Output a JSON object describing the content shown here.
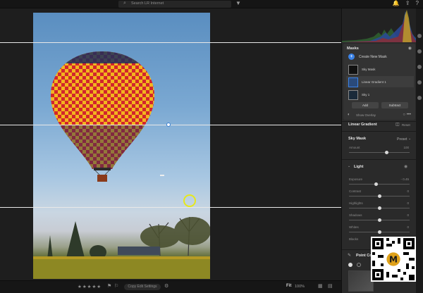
{
  "toolbar": {
    "search_placeholder": "Search LR Internet"
  },
  "masks_panel": {
    "title": "Masks",
    "create_label": "Create New Mask",
    "items": [
      {
        "label": "Sky Mask"
      },
      {
        "label": "Linear Gradient 1"
      },
      {
        "label": "Sky 1"
      }
    ],
    "add_label": "Add",
    "subtract_label": "Subtract",
    "show_overlay_label": "Show Overlay"
  },
  "adjust": {
    "section_title": "Linear Gradient",
    "reset_label": "Reset",
    "mask_name": "Sky Mask",
    "preset_label": "Preset",
    "amount_label": "Amount",
    "amount_value": "100",
    "light_title": "Light",
    "sliders": [
      {
        "label": "Exposure",
        "value": "- 0.45"
      },
      {
        "label": "Contrast",
        "value": "0"
      },
      {
        "label": "Highlights",
        "value": "0"
      },
      {
        "label": "Shadows",
        "value": "0"
      },
      {
        "label": "Whites",
        "value": "0"
      },
      {
        "label": "Blacks",
        "value": "0"
      }
    ],
    "point_color_title": "Point Color"
  },
  "filmstrip": {
    "copy_button": "Copy Edit Settings",
    "fit_label": "Fit",
    "zoom_value": "100%"
  },
  "colors": {
    "accent": "#3b82e6",
    "cursor_highlight": "#e6e81a",
    "balloon_red": "#d2252d",
    "balloon_yellow": "#f2b51e",
    "balloon_navy": "#1f2f5c"
  }
}
